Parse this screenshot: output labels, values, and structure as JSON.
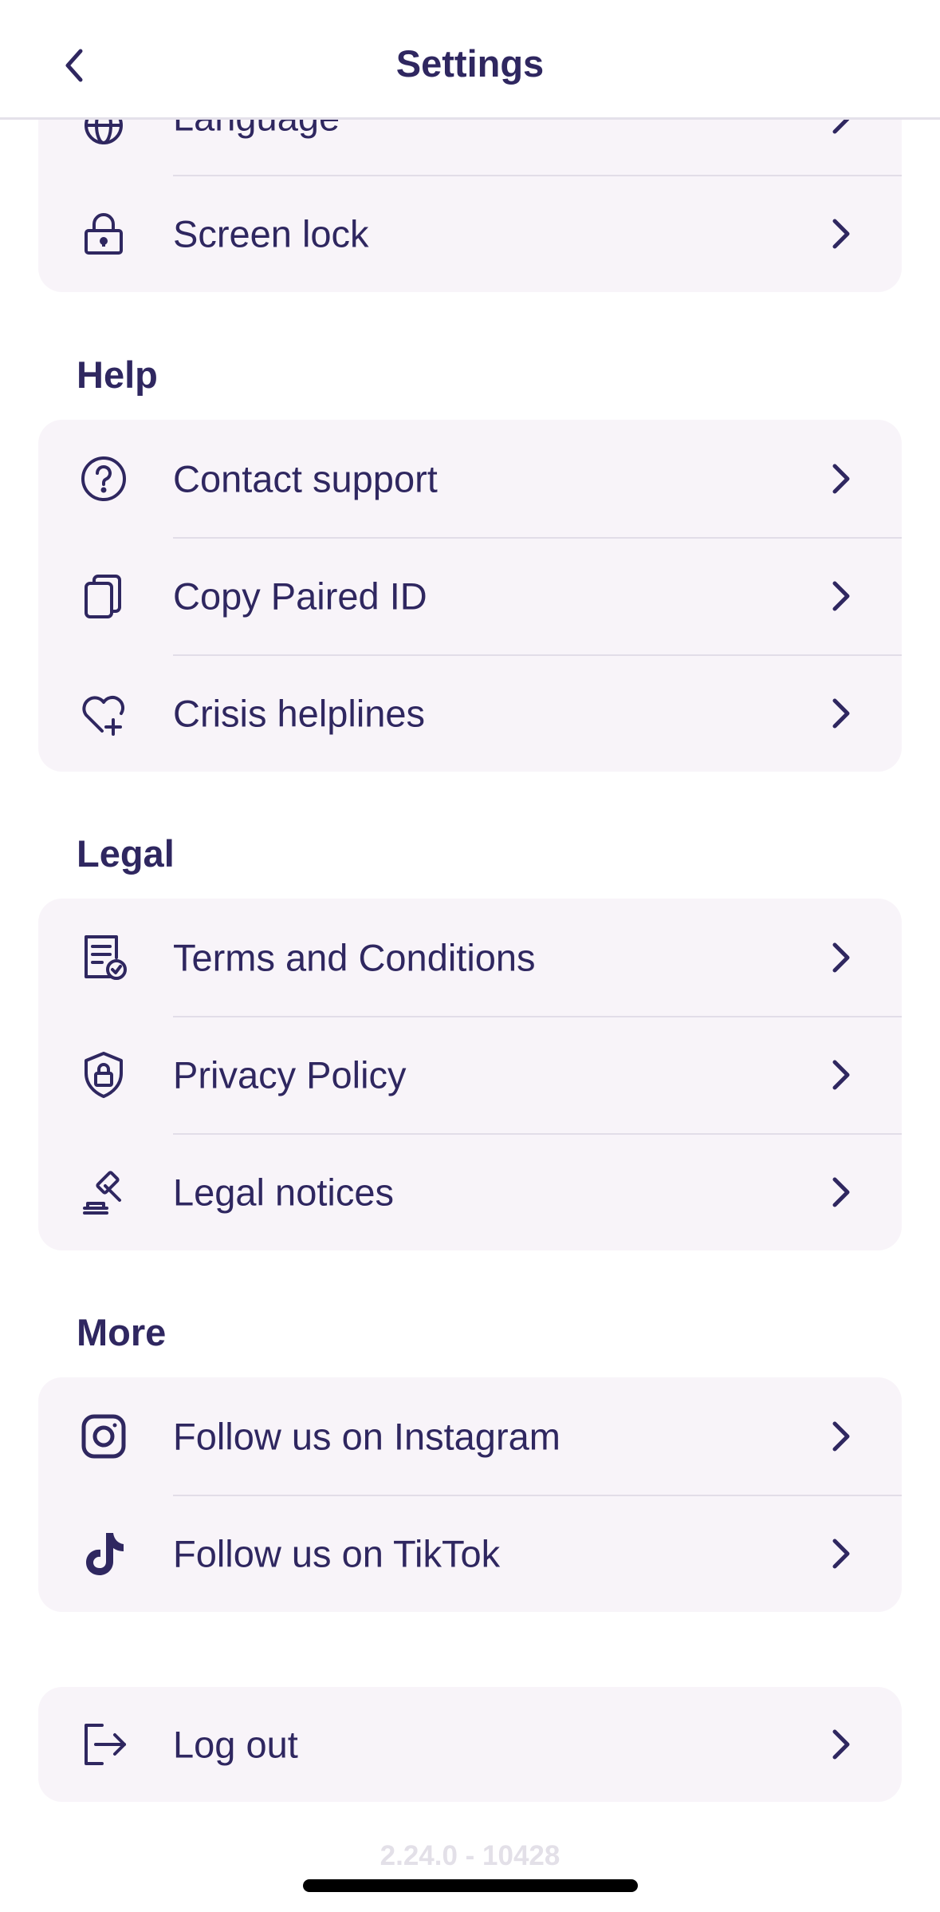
{
  "header": {
    "title": "Settings",
    "back_icon": "chevron-left-icon"
  },
  "general": {
    "items": [
      {
        "label": "Language",
        "icon": "globe-icon"
      },
      {
        "label": "Screen lock",
        "icon": "lock-icon"
      }
    ]
  },
  "help": {
    "title": "Help",
    "items": [
      {
        "label": "Contact support",
        "icon": "question-circle-icon"
      },
      {
        "label": "Copy Paired ID",
        "icon": "copy-icon"
      },
      {
        "label": "Crisis helplines",
        "icon": "heart-plus-icon"
      }
    ]
  },
  "legal": {
    "title": "Legal",
    "items": [
      {
        "label": "Terms and Conditions",
        "icon": "document-check-icon"
      },
      {
        "label": "Privacy Policy",
        "icon": "shield-lock-icon"
      },
      {
        "label": "Legal notices",
        "icon": "gavel-icon"
      }
    ]
  },
  "more": {
    "title": "More",
    "items": [
      {
        "label": "Follow us on Instagram",
        "icon": "instagram-icon"
      },
      {
        "label": "Follow us on TikTok",
        "icon": "tiktok-icon"
      }
    ]
  },
  "account": {
    "items": [
      {
        "label": "Log out",
        "icon": "logout-icon"
      }
    ]
  },
  "footer": {
    "version": "2.24.0 - 10428"
  },
  "colors": {
    "text": "#2f2760",
    "row_background": "#f8f4f9",
    "divider": "#e2dde8",
    "version_text": "#e3e0e8"
  }
}
